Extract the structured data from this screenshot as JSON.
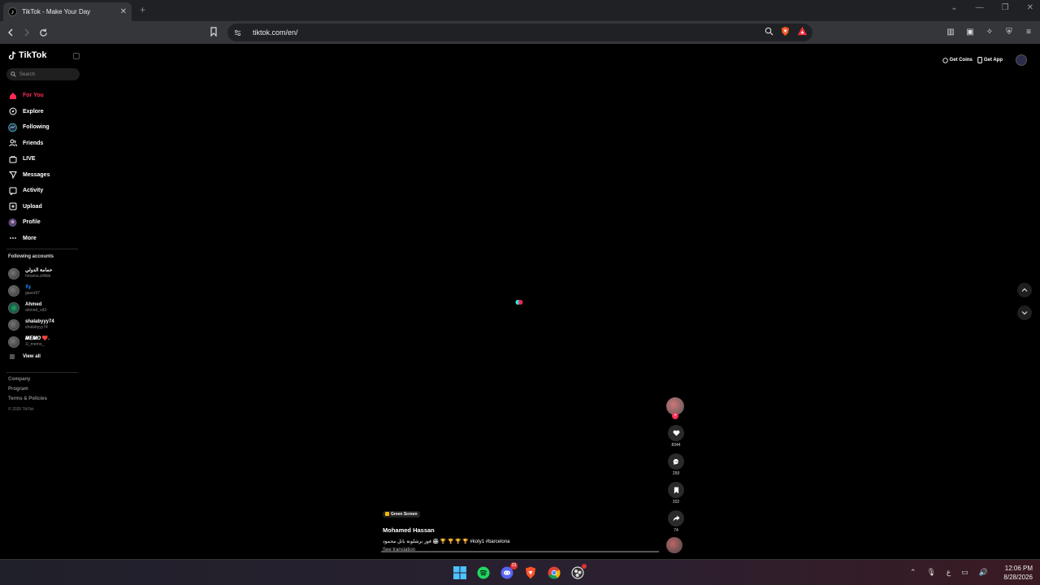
{
  "browser": {
    "tab_title": "TikTok - Make Your Day",
    "new_tab": "+",
    "url": "tiktok.com/en/"
  },
  "tiktok": {
    "logo": "TikTok",
    "search_placeholder": "Search",
    "nav": [
      {
        "label": "For You",
        "icon": "home-icon",
        "active": true
      },
      {
        "label": "Explore",
        "icon": "compass-icon"
      },
      {
        "label": "Following",
        "icon": "following-avatar-icon"
      },
      {
        "label": "Friends",
        "icon": "friends-icon"
      },
      {
        "label": "LIVE",
        "icon": "live-icon"
      },
      {
        "label": "Messages",
        "icon": "send-icon"
      },
      {
        "label": "Activity",
        "icon": "activity-icon"
      },
      {
        "label": "Upload",
        "icon": "upload-icon"
      },
      {
        "label": "Profile",
        "icon": "profile-avatar-icon"
      },
      {
        "label": "More",
        "icon": "more-icon"
      }
    ],
    "following_title": "Following accounts",
    "following": [
      {
        "name": "حمامة الدولي",
        "handle": "hmama.st4ble"
      },
      {
        "name": "👣",
        "handle": "gasor97"
      },
      {
        "name": "Ahmed",
        "handle": "ahmed_vd3"
      },
      {
        "name": "shalabyyy74",
        "handle": "shalabyyy74"
      },
      {
        "name": "𝑴𝑬𝑴𝑶 ❤️.",
        "handle": "1l_memo_"
      }
    ],
    "view_all": "View all",
    "footer": [
      "Company",
      "Program",
      "Terms & Policies"
    ],
    "copyright": "© 2026 TikTok",
    "get_coins": "Get Coins",
    "get_app": "Get App",
    "video": {
      "effect": "Green Screen",
      "creator": "Mohamed Hassan",
      "caption": "فوز برشلونة باتل محمود 🏟 🏆 🏆 🏆 🏆 #koty1 #barcelona",
      "see_translation": "See translation",
      "likes": "8344",
      "comments": "259",
      "saves": "202",
      "shares": "74"
    }
  },
  "taskbar": {
    "time": "12:06 PM",
    "date": "8/28/2026",
    "discord_badge": "23",
    "lang": "ع"
  }
}
